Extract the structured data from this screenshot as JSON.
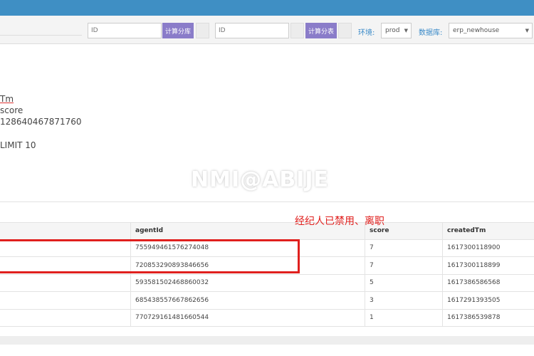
{
  "toolbar": {
    "id_placeholder_1": "ID",
    "calc_db_button": "计算分库",
    "id_placeholder_2": "ID",
    "calc_table_button": "计算分表",
    "env_label": "环境:",
    "env_value": "prod",
    "db_label": "数据库:",
    "db_value": "erp_newhouse"
  },
  "sql": {
    "line1": "Tm",
    "line2": "score",
    "line3": "128640467871760",
    "line4": "LIMIT 10"
  },
  "watermark": "NMI@ABIJE",
  "annotation": "经纪人已禁用、离职",
  "table": {
    "headers": [
      "",
      "agentId",
      "score",
      "createdTm"
    ],
    "rows": [
      [
        "",
        "755949461576274048",
        "7",
        "1617300118900"
      ],
      [
        "",
        "720853290893846656",
        "7",
        "1617300118899"
      ],
      [
        "",
        "593581502468860032",
        "5",
        "1617386586568"
      ],
      [
        "",
        "685438557667862656",
        "3",
        "1617291393505"
      ],
      [
        "",
        "770729161481660544",
        "1",
        "1617386539878"
      ]
    ]
  },
  "colors": {
    "topbar": "#3f8fc4",
    "button": "#8a7cc9",
    "annotation": "#e0201e",
    "label": "#3a8ac8"
  }
}
